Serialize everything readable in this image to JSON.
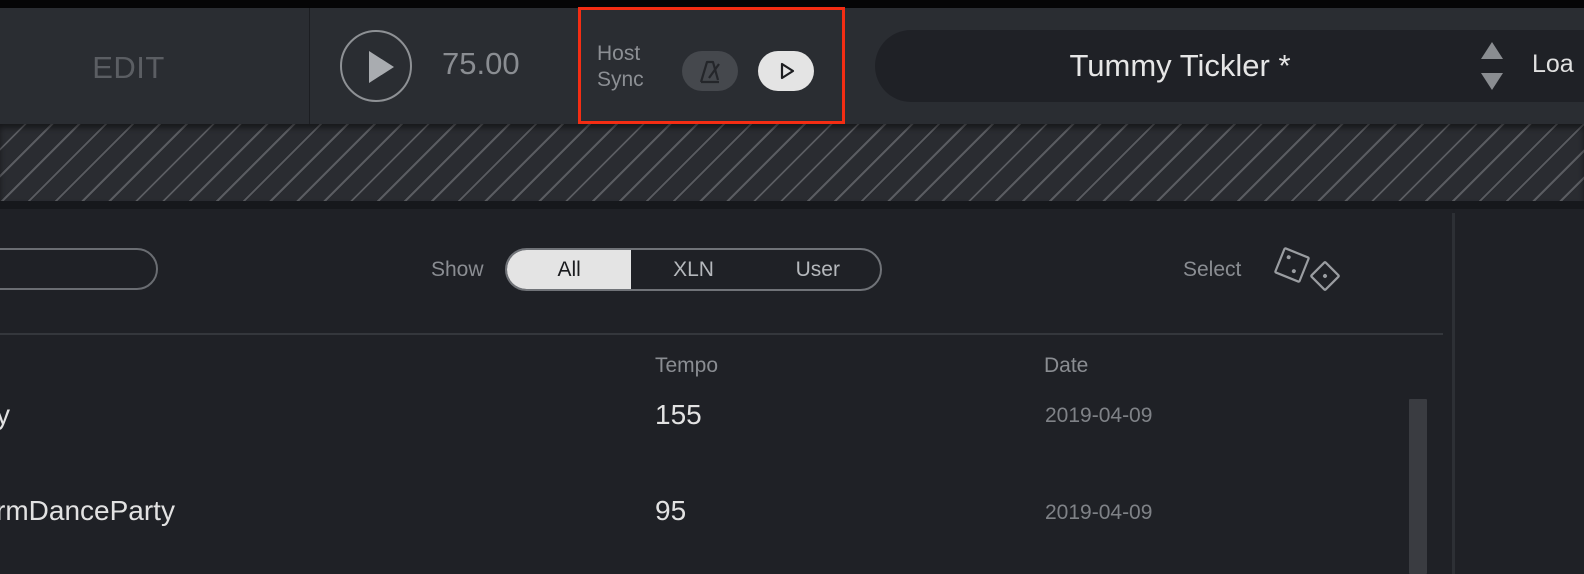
{
  "toolbar": {
    "edit_tab_label": "EDIT",
    "tempo_value": "75.00",
    "host_sync": {
      "label_line1": "Host",
      "label_line2": "Sync",
      "metronome_state": "off",
      "play_sync_state": "on",
      "highlight_color": "#f42d13"
    },
    "preset_name": "Tummy Tickler *",
    "load_label": "Loa"
  },
  "browser": {
    "show_label": "Show",
    "filter_options": [
      {
        "label": "All",
        "active": true
      },
      {
        "label": "XLN",
        "active": false
      },
      {
        "label": "User",
        "active": false
      }
    ],
    "select_label": "Select",
    "columns": {
      "tempo": "Tempo",
      "date": "Date"
    },
    "rows": [
      {
        "name": "y",
        "tempo": "155",
        "date": "2019-04-09"
      },
      {
        "name": "rmDanceParty",
        "tempo": "95",
        "date": "2019-04-09"
      }
    ]
  },
  "icons": {
    "play": "play-icon",
    "metronome": "metronome-icon",
    "play_sync": "play-outline-icon",
    "preset_up": "arrow-up-icon",
    "preset_down": "arrow-down-icon",
    "dice": "dice-icon"
  }
}
